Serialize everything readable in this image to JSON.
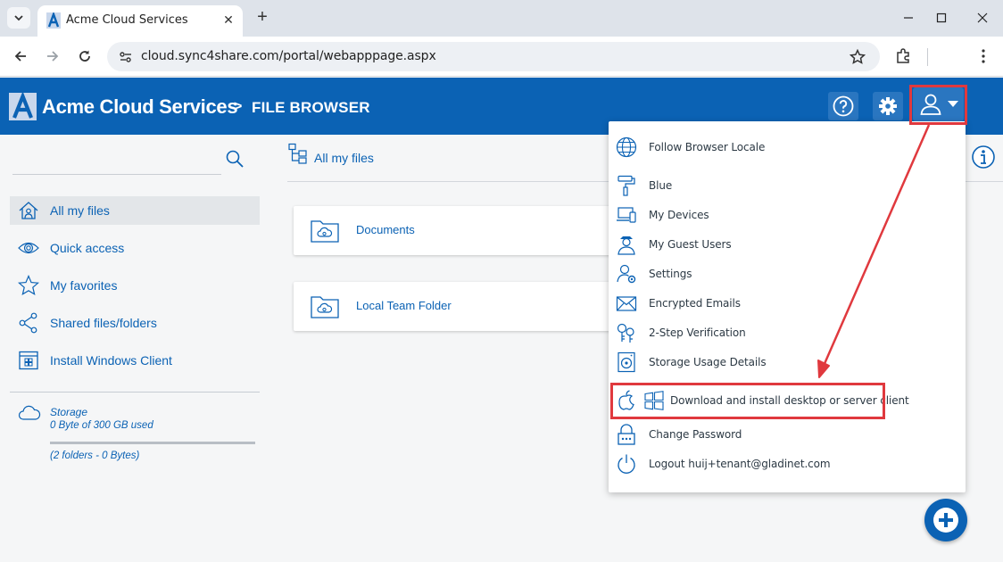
{
  "browser": {
    "tab_title": "Acme Cloud Services",
    "url": "cloud.sync4share.com/portal/webapppage.aspx"
  },
  "header": {
    "brand": "Acme Cloud Services",
    "separator": ">",
    "page": "FILE BROWSER"
  },
  "sidebar": {
    "items": [
      {
        "label": "All my files",
        "icon": "home-icon"
      },
      {
        "label": "Quick access",
        "icon": "eye-icon"
      },
      {
        "label": "My favorites",
        "icon": "star-icon"
      },
      {
        "label": "Shared files/folders",
        "icon": "share-icon"
      },
      {
        "label": "Install Windows Client",
        "icon": "windows-client-icon"
      }
    ],
    "storage": {
      "title": "Storage",
      "used": "0 Byte of 300 GB used",
      "used_fraction": 0,
      "summary": "(2 folders - 0 Bytes)"
    }
  },
  "main": {
    "breadcrumb": "All my files",
    "folders": [
      {
        "name": "Documents"
      },
      {
        "name": "Local Team Folder"
      }
    ]
  },
  "user_menu": {
    "items": [
      {
        "label": "Follow Browser Locale",
        "icon": "globe-icon"
      },
      {
        "label": "Blue",
        "icon": "paint-roller-icon"
      },
      {
        "label": "My Devices",
        "icon": "devices-icon"
      },
      {
        "label": "My Guest Users",
        "icon": "guest-user-icon"
      },
      {
        "label": "Settings",
        "icon": "user-settings-icon"
      },
      {
        "label": "Encrypted Emails",
        "icon": "encrypted-email-icon"
      },
      {
        "label": "2-Step Verification",
        "icon": "two-step-icon"
      },
      {
        "label": "Storage Usage Details",
        "icon": "storage-usage-icon"
      },
      {
        "label": "Download and install desktop or server client",
        "icon": "apple-windows-icon"
      },
      {
        "label": "Change Password",
        "icon": "lock-icon"
      },
      {
        "label": "Logout huij+tenant@gladinet.com",
        "icon": "power-icon"
      }
    ]
  },
  "colors": {
    "brand": "#0b62b4",
    "annotation": "#e0393e"
  }
}
